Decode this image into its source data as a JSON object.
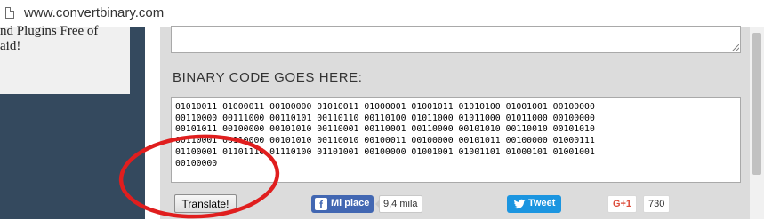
{
  "browser": {
    "url": "www.convertbinary.com"
  },
  "sidebar": {
    "lines": [
      "nd Plugins Free of",
      "aid!"
    ]
  },
  "main": {
    "section_title": "BINARY CODE GOES HERE:",
    "binary_text": "01010011 01000011 00100000 01010011 01000001 01001011 01010100 01001001 00100000\n00110000 00111000 00110101 00110110 00110100 01011000 01011000 01011000 00100000\n00101011 00100000 00101010 00110001 00110001 00110000 00101010 00110010 00101010\n00110001 00110000 00101010 00110010 00100011 00100000 00101011 00100000 01000111\n01100001 01101110 01110100 01101001 00100000 01001001 01001101 01000101 01001001\n00100000",
    "translate_label": "Translate!"
  },
  "social": {
    "facebook_label": "Mi piace",
    "facebook_count": "9,4 mila",
    "twitter_label": "Tweet",
    "gplus_label": "G+1",
    "gplus_count": "730"
  },
  "colors": {
    "sidebar": "#34495e",
    "panel": "#dcdcdc",
    "facebook": "#4267b2",
    "twitter": "#1b95e0",
    "gplus": "#dd4b39",
    "annotation": "#e01e1e"
  },
  "icons": {
    "address_bar": "page-icon",
    "facebook": "facebook-logo-icon",
    "twitter": "twitter-bird-icon"
  }
}
